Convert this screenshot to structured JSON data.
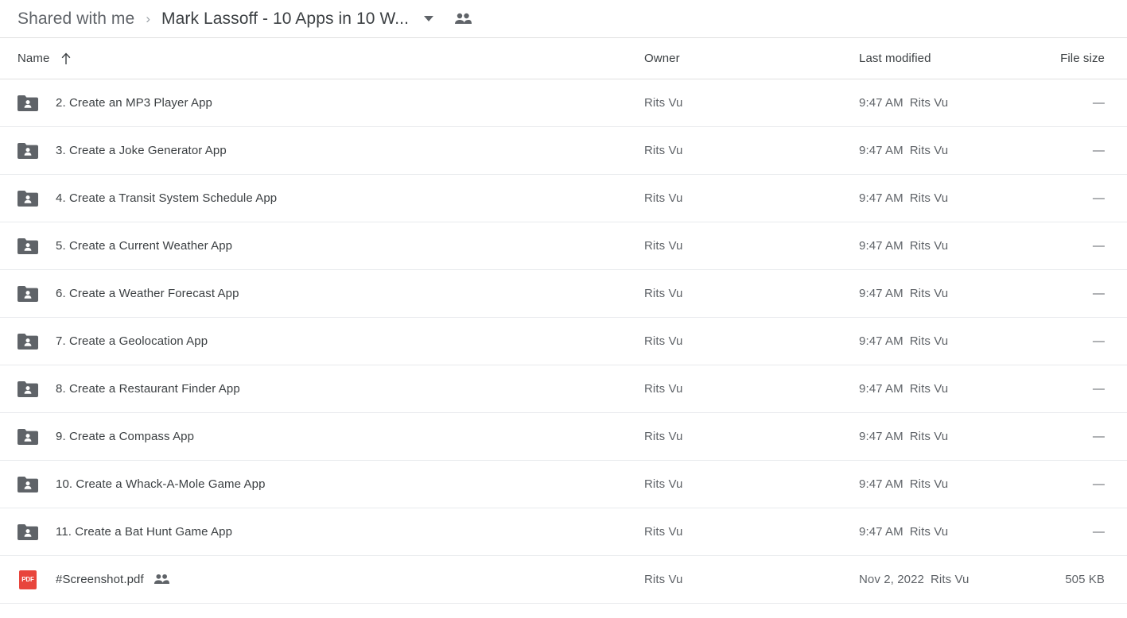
{
  "breadcrumb": {
    "root_label": "Shared with me",
    "separator": "›",
    "current_label": "Mark Lassoff - 10 Apps in 10 W...",
    "caret_icon": "chevron-down-icon",
    "people_icon": "people-shared-icon"
  },
  "columns": {
    "name": "Name",
    "owner": "Owner",
    "modified": "Last modified",
    "size": "File size",
    "sort_icon": "arrow-up-icon"
  },
  "colors": {
    "folder_icon": "#5f6368",
    "pdf_icon": "#e8453c",
    "primary_text": "#3c4043",
    "secondary_text": "#5f6368",
    "divider": "#e8eaed"
  },
  "rows": [
    {
      "icon": "shared-folder-icon",
      "name": "2. Create an MP3 Player App",
      "owner": "Rits Vu",
      "modified_time": "9:47 AM",
      "modified_by": "Rits Vu",
      "size": "—",
      "shared": false
    },
    {
      "icon": "shared-folder-icon",
      "name": "3. Create a Joke Generator App",
      "owner": "Rits Vu",
      "modified_time": "9:47 AM",
      "modified_by": "Rits Vu",
      "size": "—",
      "shared": false
    },
    {
      "icon": "shared-folder-icon",
      "name": "4. Create a Transit System Schedule App",
      "owner": "Rits Vu",
      "modified_time": "9:47 AM",
      "modified_by": "Rits Vu",
      "size": "—",
      "shared": false
    },
    {
      "icon": "shared-folder-icon",
      "name": "5. Create a Current Weather App",
      "owner": "Rits Vu",
      "modified_time": "9:47 AM",
      "modified_by": "Rits Vu",
      "size": "—",
      "shared": false
    },
    {
      "icon": "shared-folder-icon",
      "name": "6. Create a Weather Forecast App",
      "owner": "Rits Vu",
      "modified_time": "9:47 AM",
      "modified_by": "Rits Vu",
      "size": "—",
      "shared": false
    },
    {
      "icon": "shared-folder-icon",
      "name": "7. Create a Geolocation App",
      "owner": "Rits Vu",
      "modified_time": "9:47 AM",
      "modified_by": "Rits Vu",
      "size": "—",
      "shared": false
    },
    {
      "icon": "shared-folder-icon",
      "name": "8. Create a Restaurant Finder App",
      "owner": "Rits Vu",
      "modified_time": "9:47 AM",
      "modified_by": "Rits Vu",
      "size": "—",
      "shared": false
    },
    {
      "icon": "shared-folder-icon",
      "name": "9. Create a Compass App",
      "owner": "Rits Vu",
      "modified_time": "9:47 AM",
      "modified_by": "Rits Vu",
      "size": "—",
      "shared": false
    },
    {
      "icon": "shared-folder-icon",
      "name": "10. Create a Whack-A-Mole Game App",
      "owner": "Rits Vu",
      "modified_time": "9:47 AM",
      "modified_by": "Rits Vu",
      "size": "—",
      "shared": false
    },
    {
      "icon": "shared-folder-icon",
      "name": "11. Create a Bat Hunt Game App",
      "owner": "Rits Vu",
      "modified_time": "9:47 AM",
      "modified_by": "Rits Vu",
      "size": "—",
      "shared": false
    },
    {
      "icon": "pdf-file-icon",
      "name": "#Screenshot.pdf",
      "owner": "Rits Vu",
      "modified_time": "Nov 2, 2022",
      "modified_by": "Rits Vu",
      "size": "505 KB",
      "shared": true,
      "icon_label": "PDF"
    }
  ]
}
